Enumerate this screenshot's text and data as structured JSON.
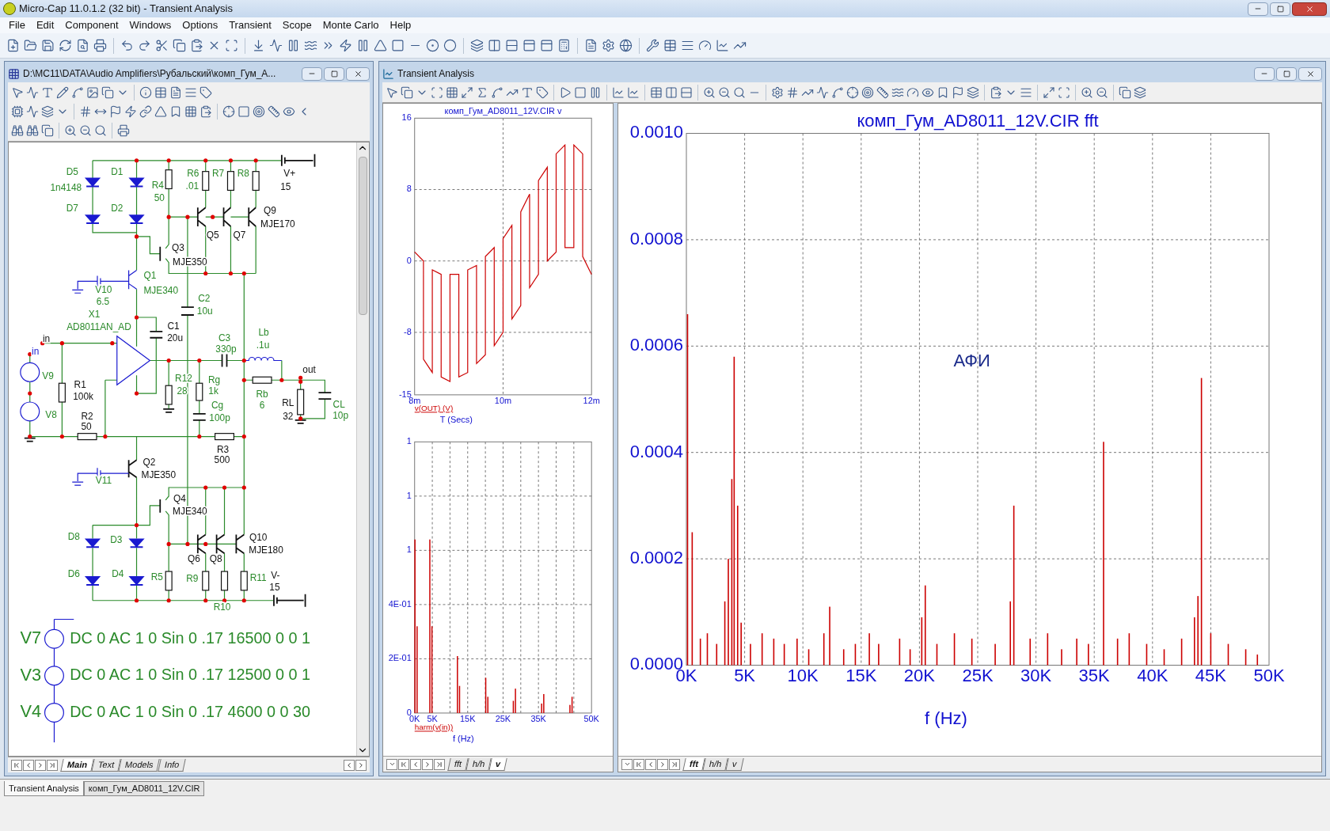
{
  "window": {
    "title": "Micro-Cap 11.0.1.2 (32 bit) - Transient Analysis"
  },
  "menu": [
    "File",
    "Edit",
    "Component",
    "Windows",
    "Options",
    "Transient",
    "Scope",
    "Monte Carlo",
    "Help"
  ],
  "schematic_window": {
    "title": "D:\\MC11\\DATA\\Audio Amplifiers\\Рубальский\\комп_Гум_А...",
    "labels": [
      "D5",
      "1n4148",
      "D1",
      "R4",
      "50",
      "R6",
      ".01",
      "R7",
      "R8",
      "V+",
      "15",
      "D7",
      "D2",
      "Q9",
      "MJE170",
      "Q5",
      "Q7",
      "Q3",
      "MJE350",
      "Q1",
      "MJE340",
      "V10",
      "6.5",
      "C2",
      "10u",
      "X1",
      "AD8011AN_AD",
      "C1",
      "in",
      "20u",
      "in",
      "C3",
      "330p",
      "Lb",
      ".1u",
      "out",
      "V9",
      "R1",
      "100k",
      "R12",
      "28",
      "Rg",
      "1k",
      "Rb",
      "Cg",
      "6",
      "RL",
      "CL",
      "V8",
      "R2",
      "100p",
      "32",
      "10p",
      "50",
      "R3",
      "500",
      "Q2",
      "MJE350",
      "V11",
      "Q4",
      "MJE340",
      "D8",
      "D3",
      "Q10",
      "MJE180",
      "Q6",
      "Q8",
      "D6",
      "D4",
      "R5",
      "R9",
      "R11",
      "V-",
      "15",
      "R10"
    ],
    "sources": [
      {
        "name": "V7",
        "value": "DC 0 AC 1 0 Sin 0 .17 16500 0 0 1"
      },
      {
        "name": "V3",
        "value": "DC 0 AC 1 0 Sin 0 .17 12500 0 0 1"
      },
      {
        "name": "V4",
        "value": "DC 0 AC 1 0 Sin 0 .17 4600 0 0 30"
      }
    ],
    "tabs": [
      {
        "label": "Main",
        "selected": true
      },
      {
        "label": "Text",
        "selected": false
      },
      {
        "label": "Models",
        "selected": false
      },
      {
        "label": "Info",
        "selected": false
      }
    ]
  },
  "analysis_window": {
    "title": "Transient Analysis",
    "time_plot": {
      "chart_data": {
        "type": "line",
        "title": "комп_Гум_AD8011_12V.CIR v",
        "xlabel": "T (Secs)",
        "x": [
          8,
          8.2,
          8.2,
          8.4,
          8.4,
          8.6,
          8.6,
          8.8,
          8.8,
          9,
          9,
          9.2,
          9.2,
          9.4,
          9.4,
          9.6,
          9.6,
          9.8,
          9.8,
          10,
          10,
          10.2,
          10.2,
          10.4,
          10.4,
          10.6,
          10.6,
          10.8,
          10.8,
          11,
          11,
          11.2,
          11.2,
          11.4,
          11.4,
          11.6,
          11.6,
          11.8,
          11.8,
          12
        ],
        "series": [
          {
            "name": "v(OUT) (V)",
            "color": "#cc0000",
            "values": [
              1,
              0,
              -11,
              -12.5,
              -1,
              -1.5,
              -13,
              -13.5,
              -1.5,
              -1.5,
              -13,
              -12.5,
              -1,
              -0.5,
              -11.5,
              -10.5,
              0.5,
              1.5,
              -9.5,
              -8,
              2.5,
              4,
              -6.5,
              -5,
              5.5,
              7.5,
              -3,
              -1.5,
              9,
              10.5,
              0,
              1,
              12,
              13,
              1.5,
              1.5,
              13,
              12,
              0.5,
              -1.5
            ]
          }
        ],
        "xlim": [
          8,
          12
        ],
        "ylim": [
          -15,
          16
        ],
        "xticks": [
          {
            "value": 8,
            "label": "8m"
          },
          {
            "value": 10,
            "label": "10m"
          },
          {
            "value": 12,
            "label": "12m"
          }
        ],
        "yticks": [
          -15,
          -8,
          0,
          8,
          16
        ],
        "grid": true
      }
    },
    "harm_plot": {
      "chart_data": {
        "type": "bar",
        "xlabel": "f (Hz)",
        "x": [
          0.1,
          0.7,
          4.3,
          4.9,
          12.1,
          12.7,
          20.1,
          20.7,
          27.9,
          28.5,
          35.9,
          36.5,
          43.9,
          44.5
        ],
        "series": [
          {
            "name": "harm(v(in))",
            "color": "#cc0000",
            "values": [
              0.64,
              0.32,
              0.64,
              0.32,
              0.21,
              0.1,
              0.13,
              0.06,
              0.045,
              0.09,
              0.035,
              0.07,
              0.03,
              0.06
            ]
          }
        ],
        "xlim": [
          0,
          50
        ],
        "ylim": [
          0,
          1
        ],
        "xticks": [
          {
            "value": 0,
            "label": "0K"
          },
          {
            "value": 5,
            "label": "5K"
          },
          {
            "value": 15,
            "label": "15K"
          },
          {
            "value": 25,
            "label": "25K"
          },
          {
            "value": 35,
            "label": "35K"
          },
          {
            "value": 50,
            "label": "50K"
          }
        ],
        "yticks": [
          {
            "value": 0,
            "label": "0"
          },
          {
            "value": 0.2,
            "label": "2E-01"
          },
          {
            "value": 0.4,
            "label": "4E-01"
          },
          {
            "value": 0.6,
            "label": "1"
          },
          {
            "value": 0.8,
            "label": "1"
          },
          {
            "value": 1,
            "label": "1"
          }
        ],
        "grid": true
      }
    },
    "time_pane_tabs": [
      {
        "label": "fft",
        "selected": false
      },
      {
        "label": "h/h",
        "selected": false
      },
      {
        "label": "v",
        "selected": true
      }
    ],
    "fft_plot": {
      "chart_data": {
        "type": "bar",
        "title": "комп_Гум_AD8011_12V.CIR fft",
        "xlabel": "f (Hz)",
        "x": [
          0.1,
          0.5,
          1.2,
          1.8,
          2.6,
          3.3,
          3.6,
          3.9,
          4.1,
          4.4,
          4.7,
          5.5,
          6.5,
          7.5,
          8.4,
          9.5,
          10.5,
          11.8,
          12.3,
          13.5,
          14.5,
          15.7,
          16.5,
          18.3,
          19.2,
          20.2,
          20.5,
          21.5,
          23,
          24.5,
          26.5,
          27.8,
          28.1,
          29.5,
          31,
          32.2,
          33.5,
          34.5,
          35.8,
          37,
          38,
          39.5,
          41,
          42.5,
          43.6,
          43.9,
          44.2,
          45,
          46.5,
          48,
          49
        ],
        "series": [
          {
            "color": "#cc0000",
            "values": [
              0.00066,
              0.00025,
              5e-05,
              6e-05,
              4e-05,
              0.00012,
              0.0002,
              0.00035,
              0.00058,
              0.0003,
              8e-05,
              4e-05,
              6e-05,
              5e-05,
              4e-05,
              5e-05,
              3e-05,
              6e-05,
              0.00011,
              3e-05,
              4e-05,
              6e-05,
              4e-05,
              5e-05,
              3e-05,
              9e-05,
              0.00015,
              4e-05,
              6e-05,
              5e-05,
              4e-05,
              0.00012,
              0.0003,
              5e-05,
              6e-05,
              3e-05,
              5e-05,
              4e-05,
              0.00042,
              5e-05,
              6e-05,
              4e-05,
              3e-05,
              5e-05,
              9e-05,
              0.00013,
              0.00054,
              6e-05,
              4e-05,
              3e-05,
              2e-05
            ]
          }
        ],
        "xlim": [
          0,
          50
        ],
        "ylim": [
          0,
          0.001
        ],
        "xticks": [
          {
            "value": 0,
            "label": "0K"
          },
          {
            "value": 5,
            "label": "5K"
          },
          {
            "value": 10,
            "label": "10K"
          },
          {
            "value": 15,
            "label": "15K"
          },
          {
            "value": 20,
            "label": "20K"
          },
          {
            "value": 25,
            "label": "25K"
          },
          {
            "value": 30,
            "label": "30K"
          },
          {
            "value": 35,
            "label": "35K"
          },
          {
            "value": 40,
            "label": "40K"
          },
          {
            "value": 45,
            "label": "45K"
          },
          {
            "value": 50,
            "label": "50K"
          }
        ],
        "yticks": [
          {
            "value": 0,
            "label": "0.0000"
          },
          {
            "value": 0.0002,
            "label": "0.0002"
          },
          {
            "value": 0.0004,
            "label": "0.0004"
          },
          {
            "value": 0.0006,
            "label": "0.0006"
          },
          {
            "value": 0.0008,
            "label": "0.0008"
          },
          {
            "value": 0.001,
            "label": "0.0010"
          }
        ],
        "annotations": [
          "АФИ"
        ],
        "grid": true
      }
    },
    "fft_pane_tabs": [
      {
        "label": "fft",
        "selected": true
      },
      {
        "label": "h/h",
        "selected": false
      },
      {
        "label": "v",
        "selected": false
      }
    ]
  },
  "document_tabs": [
    {
      "label": "Transient Analysis",
      "selected": true
    },
    {
      "label": "комп_Гум_AD8011_12V.CIR",
      "selected": false
    }
  ]
}
